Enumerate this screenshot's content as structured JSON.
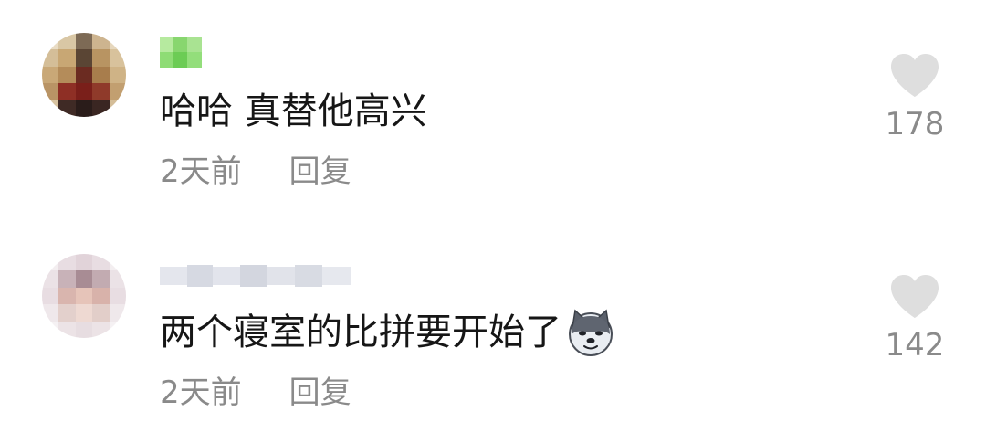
{
  "comments": [
    {
      "text": "哈哈 真替他高兴",
      "time": "2天前",
      "reply_label": "回复",
      "likes": "178",
      "emoji": null,
      "username_color": "#7ed96a"
    },
    {
      "text": "两个寝室的比拼要开始了",
      "time": "2天前",
      "reply_label": "回复",
      "likes": "142",
      "emoji": "dog-face-icon",
      "username_color": "#d9dbe3"
    }
  ],
  "colors": {
    "meta_text": "#8a8a8a",
    "heart": "#dedede",
    "comment_text": "#161616"
  }
}
